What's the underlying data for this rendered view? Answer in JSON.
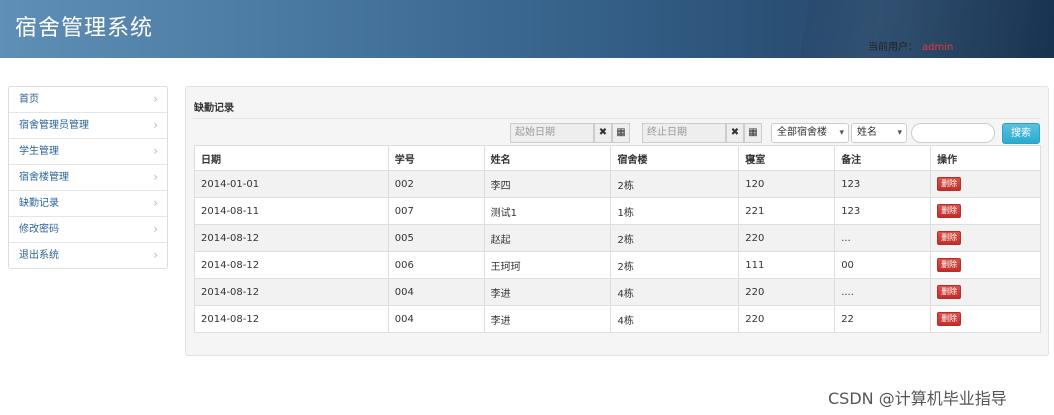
{
  "app": {
    "title": "宿舍管理系统",
    "current_user_label": "当前用户：",
    "current_user": "admin"
  },
  "sidebar": {
    "items": [
      {
        "label": "首页"
      },
      {
        "label": "宿舍管理员管理"
      },
      {
        "label": "学生管理"
      },
      {
        "label": "宿舍楼管理"
      },
      {
        "label": "缺勤记录"
      },
      {
        "label": "修改密码"
      },
      {
        "label": "退出系统"
      }
    ]
  },
  "panel": {
    "title": "缺勤记录"
  },
  "filters": {
    "start_date_placeholder": "起始日期",
    "end_date_placeholder": "终止日期",
    "clear_icon": "✖",
    "calendar_icon": "▦",
    "building_select": "全部宿舍楼",
    "field_select": "姓名",
    "search_value": "",
    "search_button": "搜索"
  },
  "table": {
    "headers": [
      "日期",
      "学号",
      "姓名",
      "宿舍楼",
      "寝室",
      "备注",
      "操作"
    ],
    "delete_label": "删除",
    "rows": [
      [
        "2014-01-01",
        "002",
        "李四",
        "2栋",
        "120",
        "123"
      ],
      [
        "2014-08-11",
        "007",
        "测试1",
        "1栋",
        "221",
        "123"
      ],
      [
        "2014-08-12",
        "005",
        "赵起",
        "2栋",
        "220",
        "..."
      ],
      [
        "2014-08-12",
        "006",
        "王珂珂",
        "2栋",
        "111",
        "00"
      ],
      [
        "2014-08-12",
        "004",
        "李进",
        "4栋",
        "220",
        "...."
      ],
      [
        "2014-08-12",
        "004",
        "李进",
        "4栋",
        "220",
        "22"
      ]
    ]
  },
  "watermark": "CSDN @计算机毕业指导",
  "colors": {
    "header_start": "#5f8fb6",
    "header_end": "#1f3d5e",
    "link": "#2a6496",
    "danger": "#d9534f",
    "info": "#5bc0de",
    "user_name": "#e53935"
  }
}
